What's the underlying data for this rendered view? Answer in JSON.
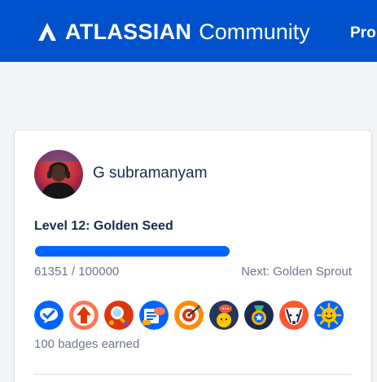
{
  "header": {
    "brand_name": "ATLASSIAN",
    "brand_sub": "Community",
    "nav_item": "Pro",
    "colors": {
      "background": "#0052cc",
      "text": "#ffffff"
    },
    "logo_icon": "atlassian-logo-icon"
  },
  "profile": {
    "user_name": "G subramanyam",
    "avatar_icon": "user-avatar",
    "level_title": "Level 12: Golden Seed",
    "progress": {
      "current": 61351,
      "target": 100000,
      "fraction": 0.6135,
      "color": "#0065ff"
    },
    "points_text": "61351 / 100000",
    "next_level_text": "Next: Golden Sprout",
    "badges": [
      {
        "icon": "checkmark-chat-badge-icon"
      },
      {
        "icon": "arrow-up-badge-icon"
      },
      {
        "icon": "magnifier-people-badge-icon"
      },
      {
        "icon": "document-chat-badge-icon"
      },
      {
        "icon": "target-arrow-badge-icon"
      },
      {
        "icon": "person-speech-badge-icon"
      },
      {
        "icon": "star-medal-badge-icon"
      },
      {
        "icon": "badger-badge-icon"
      },
      {
        "icon": "smiling-sun-badge-icon"
      }
    ],
    "badges_count_text": "100 badges earned"
  }
}
